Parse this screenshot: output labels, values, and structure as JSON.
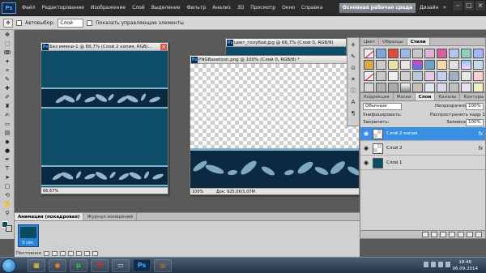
{
  "menu": {
    "items": [
      "Файл",
      "Редактирование",
      "Изображение",
      "Слой",
      "Выделение",
      "Фильтр",
      "Анализ",
      "3D",
      "Просмотр",
      "Окно",
      "Справка"
    ],
    "zoom": "66,7",
    "workspace_button": "Основная рабочая среда",
    "design_label": "Дизайн"
  },
  "options": {
    "autoselect_label": "Автовыбор:",
    "autoselect_value": "Слой",
    "show_controls_label": "Показать управляющие элементы"
  },
  "doc1": {
    "title": "Без имени-1 @ 66,7% (Слой 2 копия, RGB/...",
    "status": "66,67%"
  },
  "doc2": {
    "title": "цвет_голубой.jpg @ 66,7% (Слой 0, RGB/8)"
  },
  "doc3": {
    "title": "PNGBasetoon.png @ 100% (Слой 0, RGB/8) *",
    "status_zoom": "100%",
    "status_doc": "Док: 925,0K/1,07M"
  },
  "styles_panel": {
    "tabs": [
      "Цвет",
      "Образцы",
      "Стили"
    ],
    "active_tab": "Стили"
  },
  "layers_panel": {
    "tabs": [
      "Коррекция",
      "Маски",
      "Слои",
      "Каналы",
      "Контуры"
    ],
    "active_tab": "Слои",
    "blend_mode": "Обычные",
    "opacity_label": "Непрозрачность:",
    "opacity_value": "100%",
    "lock_label": "Закрепить:",
    "fill_label": "Заливка:",
    "fill_value": "100%",
    "unify_label": "Унифицировать:",
    "propagate_label": "Распространить кадр 1",
    "layers": [
      {
        "name": "Слой 2 копия",
        "fx": "fx",
        "selected": true
      },
      {
        "name": "Слой 2",
        "fx": "fx",
        "selected": false
      },
      {
        "name": "Слой 1",
        "fx": "",
        "selected": false
      }
    ]
  },
  "animation_panel": {
    "tabs": [
      "Анимация (покадровая)",
      "Журнал измерений"
    ],
    "frame_time": "0 сек.",
    "loop": "Постоянно"
  },
  "taskbar": {
    "time": "18:46",
    "date": "06.09.2014"
  },
  "colors": {
    "teal": "#0e4d68",
    "navy": "#0b2940",
    "leaf": "#8fb8cf",
    "selection": "#3a8ee6"
  }
}
